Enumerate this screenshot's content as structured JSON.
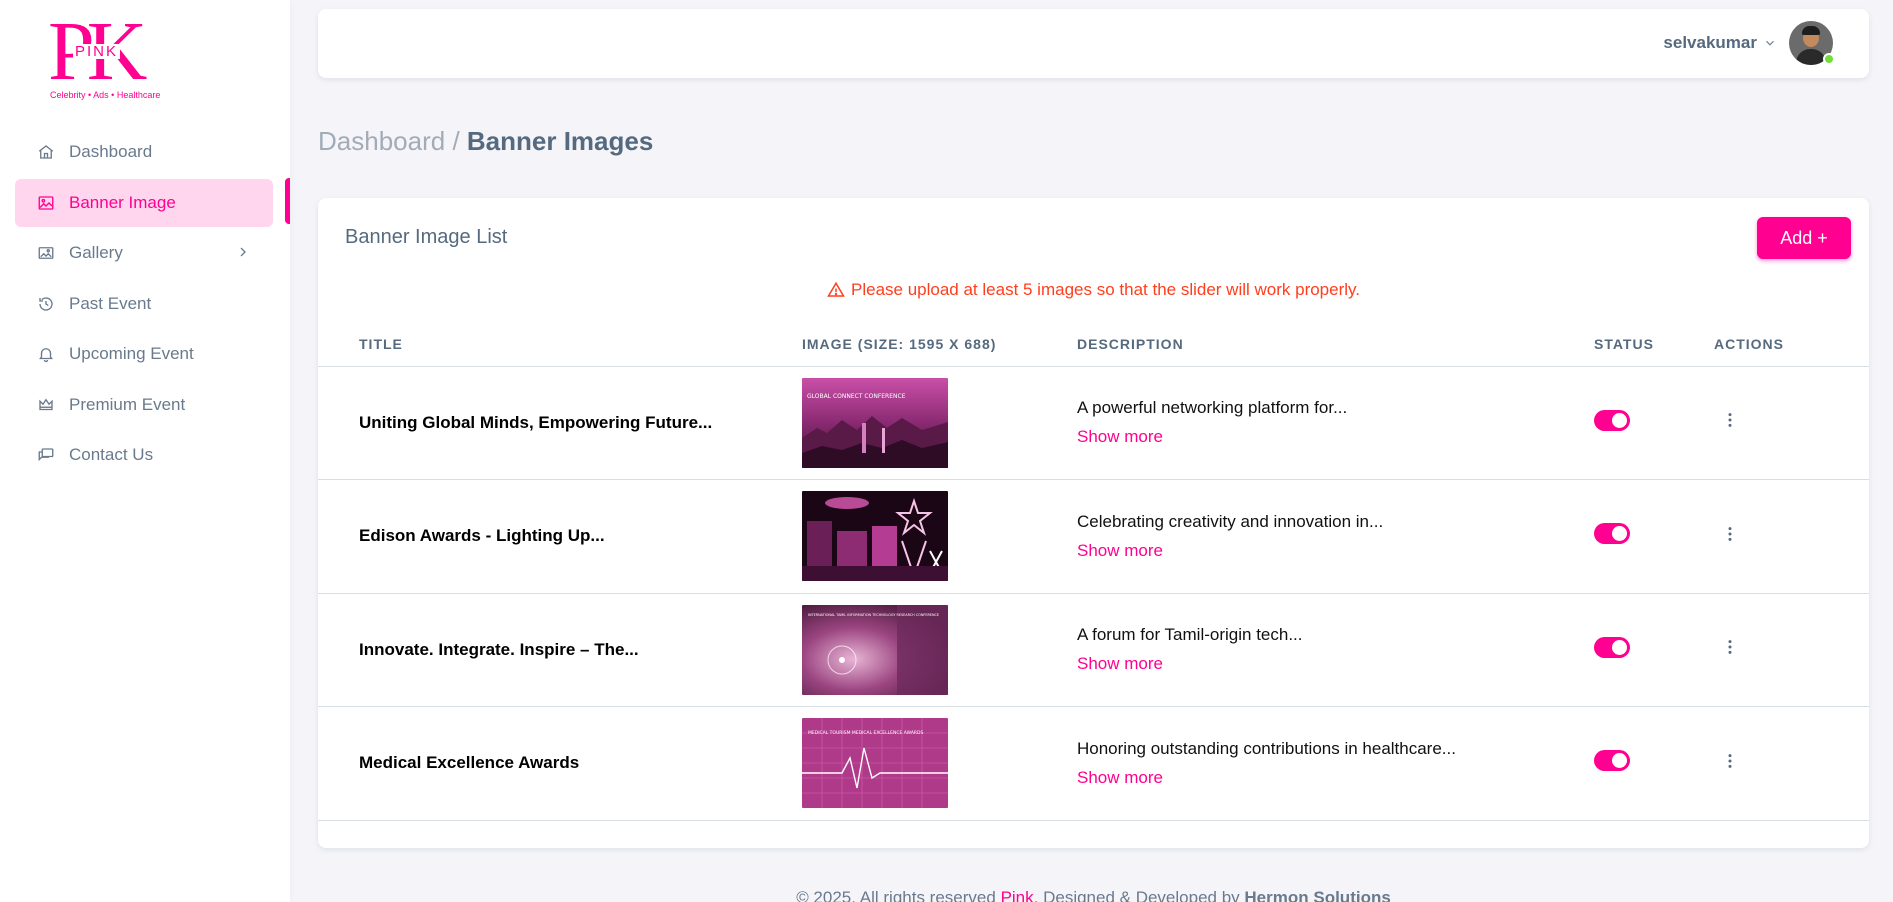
{
  "sidebar": {
    "logo": {
      "letters": "PK",
      "word": "PINK",
      "tagline": "Celebrity • Ads • Healthcare"
    },
    "items": [
      {
        "label": "Dashboard",
        "icon": "home-icon"
      },
      {
        "label": "Banner Image",
        "icon": "image-icon",
        "active": true
      },
      {
        "label": "Gallery",
        "icon": "gallery-icon",
        "has_submenu": true
      },
      {
        "label": "Past Event",
        "icon": "history-icon"
      },
      {
        "label": "Upcoming Event",
        "icon": "bell-icon"
      },
      {
        "label": "Premium Event",
        "icon": "crown-icon"
      },
      {
        "label": "Contact Us",
        "icon": "chat-icon"
      }
    ]
  },
  "header": {
    "username": "selvakumar"
  },
  "breadcrumb": {
    "parent": "Dashboard",
    "separator": "/",
    "current": "Banner Images"
  },
  "card": {
    "title": "Banner Image List",
    "add_label": "Add +",
    "warning": "Please upload at least 5 images so that the slider will work properly."
  },
  "table": {
    "columns": [
      "TITLE",
      "IMAGE (SIZE: 1595 X 688)",
      "DESCRIPTION",
      "STATUS",
      "ACTIONS"
    ],
    "rows": [
      {
        "title": "Uniting Global Minds, Empowering Future...",
        "description": "A powerful networking platform for...",
        "show_more": "Show more",
        "status": true,
        "image_caption": "GLOBAL CONNECT CONFERENCE"
      },
      {
        "title": "Edison Awards - Lighting Up...",
        "description": "Celebrating creativity and innovation in...",
        "show_more": "Show more",
        "status": true,
        "image_caption": ""
      },
      {
        "title": "Innovate. Integrate. Inspire – The...",
        "description": "A forum for Tamil-origin tech...",
        "show_more": "Show more",
        "status": true,
        "image_caption": "INTERNATIONAL TAMIL INFORMATION TECHNOLOGY RESEARCH CONFERENCE"
      },
      {
        "title": "Medical Excellence Awards",
        "description": "Honoring outstanding contributions in healthcare...",
        "show_more": "Show more",
        "status": true,
        "image_caption": "MEDICAL TOURISM MEDICAL EXCELLENCE AWARDS"
      }
    ]
  },
  "footer": {
    "prefix": "© 2025, All rights reserved",
    "brand": "Pink",
    "middle": ", Designed & Developed by",
    "company": "Hermon Solutions"
  },
  "colors": {
    "accent": "#ff0090",
    "warning": "#ff3e1d",
    "active_bg": "#ffd6ee",
    "online": "#71dd37"
  }
}
